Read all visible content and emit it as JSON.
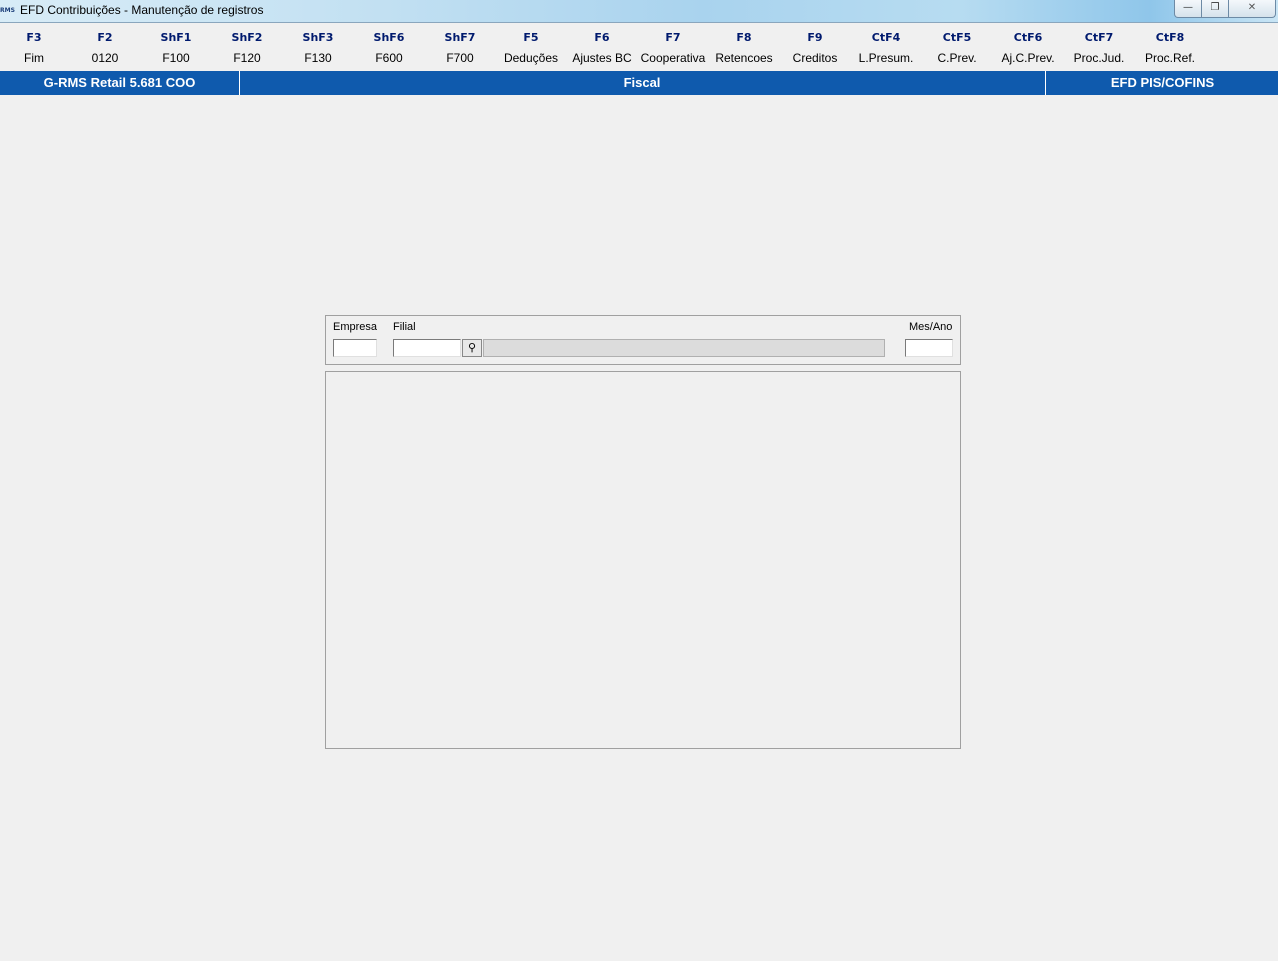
{
  "window": {
    "title": "EFD Contribuições - Manutenção de registros",
    "app_icon_text": "RMS",
    "minimize_glyph": "—",
    "maximize_glyph": "❐",
    "close_glyph": "✕"
  },
  "function_keys": [
    {
      "key": "F3",
      "label": "Fim"
    },
    {
      "key": "F2",
      "label": "0120"
    },
    {
      "key": "ShF1",
      "label": "F100"
    },
    {
      "key": "ShF2",
      "label": "F120"
    },
    {
      "key": "ShF3",
      "label": "F130"
    },
    {
      "key": "ShF6",
      "label": "F600"
    },
    {
      "key": "ShF7",
      "label": "F700"
    },
    {
      "key": "F5",
      "label": "Deduções"
    },
    {
      "key": "F6",
      "label": "Ajustes BC"
    },
    {
      "key": "F7",
      "label": "Cooperativa"
    },
    {
      "key": "F8",
      "label": "Retencoes"
    },
    {
      "key": "F9",
      "label": "Creditos"
    },
    {
      "key": "CtF4",
      "label": "L.Presum."
    },
    {
      "key": "CtF5",
      "label": "C.Prev."
    },
    {
      "key": "CtF6",
      "label": "Aj.C.Prev."
    },
    {
      "key": "CtF7",
      "label": "Proc.Jud."
    },
    {
      "key": "CtF8",
      "label": "Proc.Ref."
    }
  ],
  "statusbar": {
    "left": "G-RMS Retail 5.681 COO",
    "middle": "Fiscal",
    "right": "EFD PIS/COFINS"
  },
  "filter": {
    "empresa_label": "Empresa",
    "empresa_value": "",
    "filial_label": "Filial",
    "filial_value": "",
    "search_glyph": "⚲",
    "filial_description": "",
    "mesano_label": "Mes/Ano",
    "mesano_value": ""
  },
  "colors": {
    "statusbar_bg": "#0f5aad",
    "fkey_text": "#001a6e",
    "background": "#f0f0f0"
  }
}
